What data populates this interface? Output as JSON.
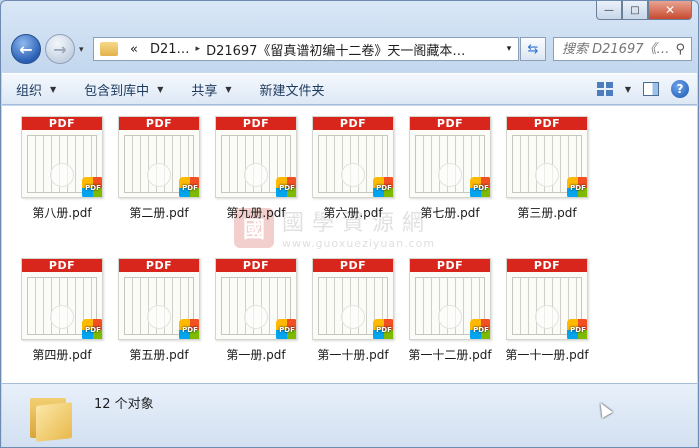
{
  "window": {
    "min_glyph": "—",
    "max_glyph": "□",
    "close_glyph": "✕"
  },
  "nav": {
    "back_glyph": "←",
    "fwd_glyph": "→",
    "drop_glyph": "▾",
    "address": {
      "chevron": "«",
      "segments": [
        "D21…",
        "D21697《留真谱初编十二卷》天一阁藏本…"
      ],
      "separator": "▸",
      "drop_glyph": "▾"
    },
    "refresh_glyph": "⇆",
    "search_placeholder": "搜索 D21697《…"
  },
  "toolbar": {
    "items": [
      {
        "label": "组织",
        "has_menu": true
      },
      {
        "label": "包含到库中",
        "has_menu": true
      },
      {
        "label": "共享",
        "has_menu": true
      },
      {
        "label": "新建文件夹",
        "has_menu": false
      }
    ],
    "tri": "▼",
    "help": "?"
  },
  "files": [
    {
      "name": "第八册.pdf"
    },
    {
      "name": "第二册.pdf"
    },
    {
      "name": "第九册.pdf"
    },
    {
      "name": "第六册.pdf"
    },
    {
      "name": "第七册.pdf"
    },
    {
      "name": "第三册.pdf"
    },
    {
      "name": "第四册.pdf"
    },
    {
      "name": "第五册.pdf"
    },
    {
      "name": "第一册.pdf"
    },
    {
      "name": "第一十册.pdf"
    },
    {
      "name": "第一十二册.pdf"
    },
    {
      "name": "第一十一册.pdf"
    }
  ],
  "thumb_banner": "PDF",
  "badge_text": "PDF",
  "watermark": {
    "logo": "國",
    "text": "國學資源網",
    "url": "www.guoxueziyuan.com"
  },
  "status": {
    "count_text": "12 个对象"
  }
}
